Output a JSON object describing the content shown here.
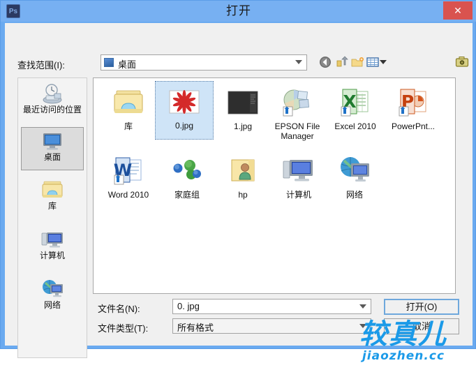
{
  "window": {
    "title": "打开",
    "app_icon": "photoshop-icon",
    "app_icon_text": "Ps",
    "close_label": "✕",
    "accent_color": "#77b0f2",
    "close_color": "#d9534f"
  },
  "lookin": {
    "label": "查找范围(I):",
    "value": "桌面"
  },
  "toolbar": {
    "buttons": [
      {
        "name": "back-icon",
        "tip": "后退"
      },
      {
        "name": "up-folder-icon",
        "tip": "向上一级"
      },
      {
        "name": "new-folder-icon",
        "tip": "新建文件夹"
      },
      {
        "name": "views-icon",
        "tip": "视图"
      }
    ],
    "right_button": {
      "name": "camera-icon",
      "tip": "工具"
    }
  },
  "places": {
    "items": [
      {
        "label": "最近访问的位置",
        "icon": "recent-places-icon",
        "selected": false
      },
      {
        "label": "桌面",
        "icon": "desktop-icon",
        "selected": true
      },
      {
        "label": "库",
        "icon": "library-folder-icon",
        "selected": false
      },
      {
        "label": "计算机",
        "icon": "computer-icon",
        "selected": false
      },
      {
        "label": "网络",
        "icon": "network-icon",
        "selected": false
      }
    ]
  },
  "files": {
    "items": [
      {
        "label": "库",
        "icon": "library-folder-icon",
        "selected": false
      },
      {
        "label": "0.jpg",
        "icon": "image-starburst-icon",
        "selected": true
      },
      {
        "label": "1.jpg",
        "icon": "image-dark-icon",
        "selected": false
      },
      {
        "label": "EPSON File Manager",
        "icon": "epson-file-manager-icon",
        "selected": false
      },
      {
        "label": "Excel 2010",
        "icon": "excel-icon",
        "selected": false
      },
      {
        "label": "PowerPnt...",
        "icon": "powerpoint-icon",
        "selected": false
      },
      {
        "label": "Word 2010",
        "icon": "word-icon",
        "selected": false
      },
      {
        "label": "家庭组",
        "icon": "homegroup-icon",
        "selected": false
      },
      {
        "label": "hp",
        "icon": "user-folder-icon",
        "selected": false
      },
      {
        "label": "计算机",
        "icon": "computer-icon",
        "selected": false
      },
      {
        "label": "网络",
        "icon": "network-icon",
        "selected": false
      }
    ]
  },
  "fields": {
    "filename_label": "文件名(N):",
    "filename_value": "0. jpg",
    "filetype_label": "文件类型(T):",
    "filetype_value": "所有格式"
  },
  "buttons": {
    "open": "打开(O)",
    "cancel": "取消"
  },
  "watermark": {
    "main": "较真儿",
    "sub": "jiaozhen.cc",
    "color": "#1b9ae8"
  }
}
